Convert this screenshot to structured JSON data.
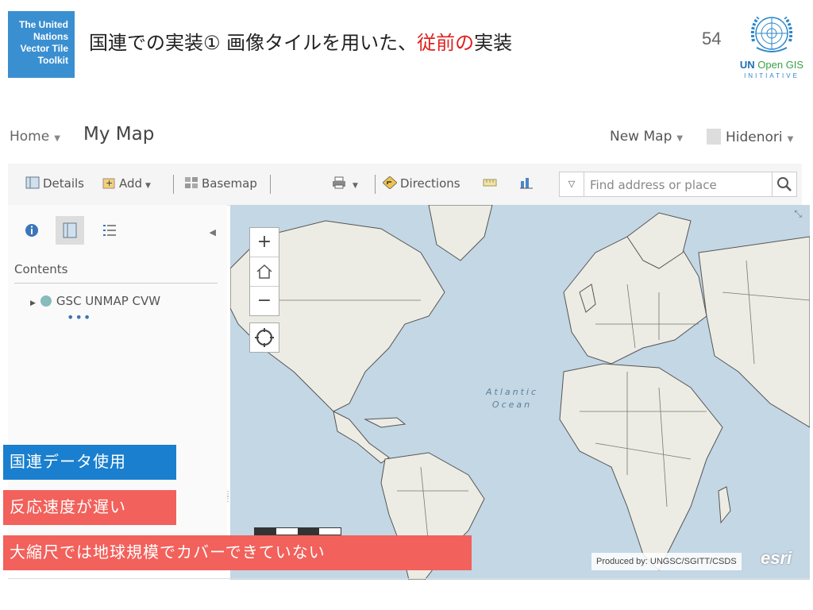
{
  "slide": {
    "toolkit_badge": [
      "The United",
      "Nations",
      "Vector Tile",
      "Toolkit"
    ],
    "title_main": "国連での実装① 画像タイルを用いた、",
    "title_accent": "従前の",
    "title_end": "実装",
    "page_number": "54",
    "logo": {
      "brand_un": "UN ",
      "brand_open": "Open GIS",
      "initiative": "INITIATIVE"
    },
    "accent_color": "#e02020"
  },
  "app": {
    "breadcrumb_home": "Home",
    "map_title": "My Map",
    "new_map": "New Map",
    "user_name": "Hidenori",
    "toolbar": {
      "details": "Details",
      "add": "Add",
      "basemap": "Basemap",
      "directions": "Directions"
    },
    "search": {
      "placeholder": "Find address or place"
    },
    "sidebar": {
      "contents_heading": "Contents",
      "layer_name": "GSC UNMAP CVW",
      "more": "•••"
    },
    "map": {
      "ocean_label_line1": "Atlantic",
      "ocean_label_line2": "Ocean",
      "attribution": "Produced by: UNGSC/SGITT/CSDS",
      "esri": "esri"
    }
  },
  "callouts": {
    "un_data": "国連データ使用",
    "slow": "反応速度が遅い",
    "no_global": "大縮尺では地球規模でカバーできていない",
    "colors": {
      "blue": "#1a7fce",
      "red": "#f2615b"
    }
  }
}
